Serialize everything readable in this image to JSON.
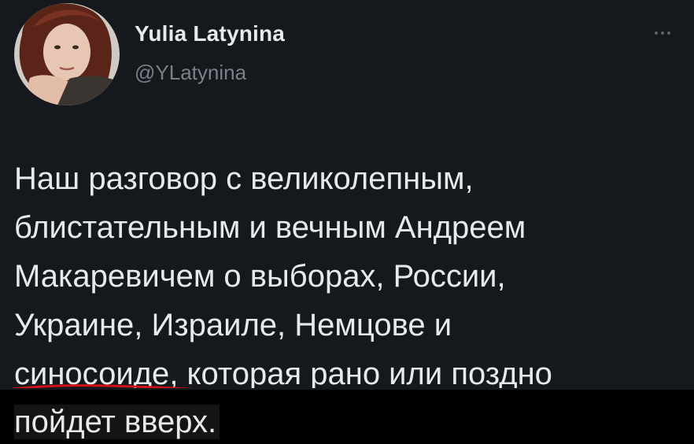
{
  "author": {
    "name": "Yulia Latynina",
    "handle": "@YLatynina"
  },
  "icons": {
    "more": "more-horizontal-icon",
    "avatar": "profile-photo"
  },
  "tweet": {
    "lines": [
      "Наш разговор с великолепным,",
      "блистательным и вечным Андреем",
      "Макаревичем о выборах, России,",
      "Украине, Израиле, Немцове и"
    ],
    "line5_underlined": "синосоиде",
    "line5_rest": ", которая рано или поздно",
    "line6": "пойдет вверх."
  },
  "colors": {
    "background": "#15181c",
    "text": "#e7e9ea",
    "handle": "#7b8088",
    "underline": "#d0111a",
    "mask": "#000000"
  }
}
